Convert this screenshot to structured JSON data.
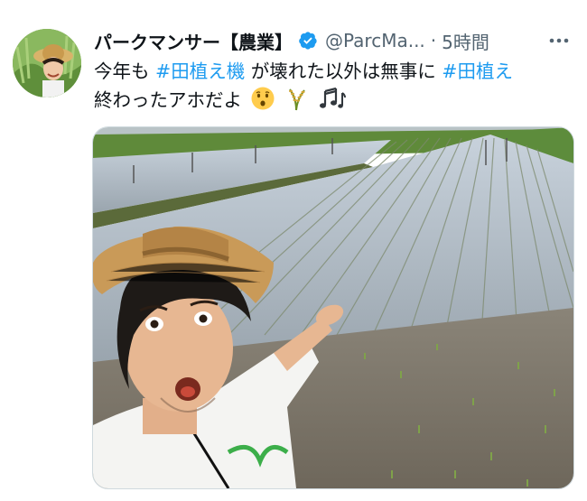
{
  "tweet": {
    "author_name": "パークマンサー【農業】",
    "handle": "@ParcMa...",
    "separator": "·",
    "time": "5時間",
    "text_part1": "今年も ",
    "hashtag1": "#田植え機",
    "text_part2": " が壊れた以外は無事に ",
    "hashtag2": "#田植え",
    "text_part3": "終わったアホだよ",
    "verified": true,
    "icons": {
      "verified": "verified-badge-icon",
      "more": "more-options-icon",
      "emoji1": "hushed-face-emoji",
      "emoji2": "rice-plant-emoji",
      "emoji3": "music-notes-emoji"
    },
    "colors": {
      "hashtag": "#1d9bf0",
      "verified": "#1d9bf0",
      "muted": "#536471"
    }
  }
}
